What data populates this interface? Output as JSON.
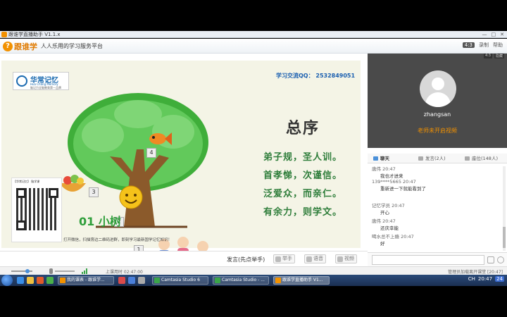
{
  "window": {
    "title": "跟谁学直播助手 V1.1.x",
    "controls": [
      "—",
      "□",
      "✕"
    ]
  },
  "app": {
    "brand": "跟谁学",
    "slogan": "人人乐用的学习服务平台",
    "aspect": "4:3",
    "right_links": [
      "录制",
      "帮助"
    ]
  },
  "slide": {
    "brand_cn": "华常记忆",
    "brand_en": "Hua Chang Memory",
    "brand_tag": "脑记力全脑教育第一品牌",
    "contact": "学习交流QQ：  2532849051",
    "title": "总序",
    "verses": [
      "弟子规，圣人训。",
      "首孝悌，次谨信。",
      "泛爱众，而亲仁。",
      "有余力，则学文。"
    ],
    "tree_label": "01 小树",
    "numbers": [
      "1",
      "2",
      "3",
      "4"
    ],
    "qr_header": "【华常记忆】 脑学课",
    "footnote": "打开微信，扫描旁边二维码进群，即刻学习最新国学记忆知识！"
  },
  "controls": {
    "speak_label": "发言(先点举手)",
    "raise_hand": "举手",
    "voice": "语音",
    "video": "视频"
  },
  "status": {
    "class_time": "上课用时 02:47:00",
    "right_text": "管理员加载离开课堂 [20:47]"
  },
  "side": {
    "username": "zhangsan",
    "video_status": "老师未开启视频",
    "top_tags": [
      "4:3",
      "隐藏"
    ],
    "tabs": [
      {
        "label": "聊天",
        "active": true
      },
      {
        "label": "发言(2人)",
        "active": false
      },
      {
        "label": "座位(148人)",
        "active": false
      }
    ],
    "messages": [
      {
        "meta": "唐伟  20:47",
        "text": "我也才进来"
      },
      {
        "meta": "139****5665  20:47",
        "text": "重新进一下就能看到了"
      },
      {
        "meta": "记忆学员  20:47",
        "text": "开心"
      },
      {
        "meta": "唐伟  20:47",
        "text": "还庆幸能"
      },
      {
        "meta": "喝水总不上瘾  20:47",
        "text": "好"
      }
    ]
  },
  "taskbar": {
    "tasks": [
      {
        "label": "我的课表 - 跟谁学...",
        "active": false
      },
      {
        "label": "Camtasia Studio 6",
        "active": false
      },
      {
        "label": "Camtasia Studio - ...",
        "active": false
      },
      {
        "label": "跟谁学直播助手 V1...",
        "active": true
      }
    ],
    "time": "20:47",
    "badge": "24",
    "tray_text": "CH"
  }
}
